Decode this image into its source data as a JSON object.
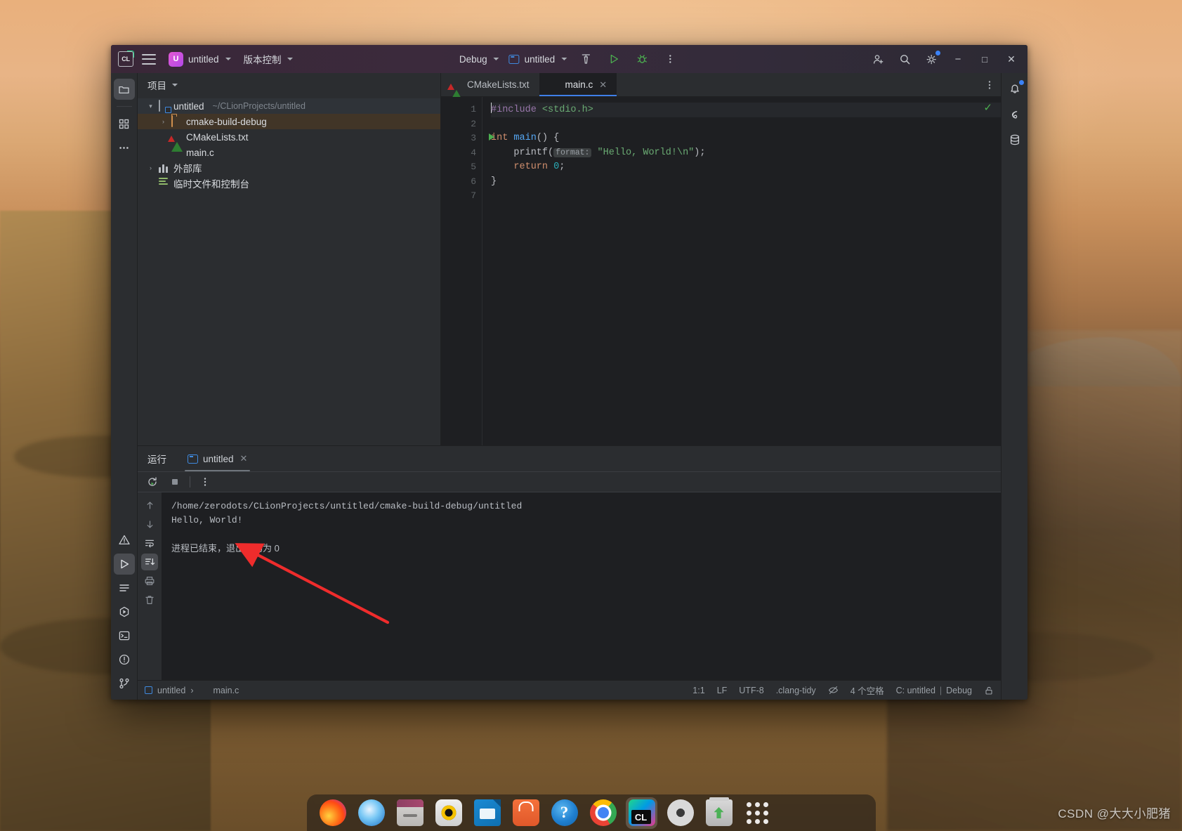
{
  "titlebar": {
    "logo": "CL",
    "menu_icon": "hamburger-menu-icon",
    "project_badge": "U",
    "project_name": "untitled",
    "vcs_label": "版本控制",
    "run_config_label": "Debug",
    "target_label": "untitled",
    "build_icon": "hammer-icon",
    "run_icon": "run-icon",
    "debug_icon": "debug-bug-icon",
    "more_icon": "more-vertical-icon",
    "account_icon": "add-user-icon",
    "search_icon": "search-icon",
    "settings_icon": "gear-icon",
    "minimize": "−",
    "maximize": "□",
    "close": "✕"
  },
  "rail_left": {
    "top": [
      {
        "name": "project-tool-window",
        "icon": "folder-icon",
        "active": true
      },
      {
        "name": "structure-tool-window",
        "icon": "blocks-icon",
        "active": false
      },
      {
        "name": "more-tool-windows",
        "icon": "ellipsis-icon",
        "active": false
      }
    ],
    "bottom": [
      {
        "name": "problems-tool-window",
        "icon": "warning-triangle-icon",
        "active": false
      },
      {
        "name": "run-tool-window",
        "icon": "run-icon",
        "active": true
      },
      {
        "name": "todo-tool-window",
        "icon": "list-lines-icon",
        "active": false
      },
      {
        "name": "debug-tool-window",
        "icon": "debug-hex-icon",
        "active": false
      },
      {
        "name": "terminal-tool-window",
        "icon": "terminal-icon",
        "active": false
      },
      {
        "name": "notifications-tool-window",
        "icon": "exclamation-circle-icon",
        "active": false
      },
      {
        "name": "git-tool-window",
        "icon": "git-branch-icon",
        "active": false
      }
    ]
  },
  "rail_right": [
    {
      "name": "notifications",
      "icon": "bell-icon",
      "badge": true
    },
    {
      "name": "ai-assistant",
      "icon": "spiral-icon",
      "badge": false
    },
    {
      "name": "database",
      "icon": "database-icon",
      "badge": false
    }
  ],
  "project_panel": {
    "title": "项目",
    "tree": [
      {
        "indent": 0,
        "twisty": "▾",
        "icon": "project-folder-icon",
        "label": "untitled",
        "sub": "~/CLionProjects/untitled",
        "state": "selected-blue"
      },
      {
        "indent": 1,
        "twisty": "›",
        "icon": "folder-icon",
        "label": "cmake-build-debug",
        "sub": "",
        "state": "selected-brown"
      },
      {
        "indent": 1,
        "twisty": "",
        "icon": "cmake-icon",
        "label": "CMakeLists.txt",
        "sub": "",
        "state": ""
      },
      {
        "indent": 1,
        "twisty": "",
        "icon": "c-file-icon",
        "label": "main.c",
        "sub": "",
        "state": ""
      },
      {
        "indent": 0,
        "twisty": "›",
        "icon": "library-icon",
        "label": "外部库",
        "sub": "",
        "state": ""
      },
      {
        "indent": 0,
        "twisty": "",
        "icon": "scratches-icon",
        "label": "临时文件和控制台",
        "sub": "",
        "state": ""
      }
    ]
  },
  "editor": {
    "tabs": [
      {
        "label": "CMakeLists.txt",
        "icon": "cmake-icon",
        "active": false,
        "closable": false
      },
      {
        "label": "main.c",
        "icon": "c-file-icon",
        "active": true,
        "closable": true
      }
    ],
    "tab_close_glyph": "✕",
    "options_icon": "more-vertical-icon",
    "inspection_status_icon": "checkmark-icon",
    "line_numbers": [
      "1",
      "2",
      "3",
      "4",
      "5",
      "6",
      "7"
    ],
    "run_gutter_line": 3,
    "code_lines": [
      {
        "n": 1,
        "tokens": [
          {
            "t": "#include ",
            "c": "pre"
          },
          {
            "t": "<stdio.h>",
            "c": "str"
          }
        ]
      },
      {
        "n": 2,
        "tokens": []
      },
      {
        "n": 3,
        "tokens": [
          {
            "t": "int ",
            "c": "kw"
          },
          {
            "t": "main",
            "c": "fn"
          },
          {
            "t": "() {",
            "c": "pl"
          }
        ]
      },
      {
        "n": 4,
        "tokens": [
          {
            "t": "    printf",
            "c": "pl"
          },
          {
            "t": "(",
            "c": "pl"
          },
          {
            "t": "format:",
            "c": "hint"
          },
          {
            "t": " ",
            "c": "pl"
          },
          {
            "t": "\"Hello, World!\\n\"",
            "c": "str"
          },
          {
            "t": ");",
            "c": "pl"
          }
        ]
      },
      {
        "n": 5,
        "tokens": [
          {
            "t": "    ",
            "c": "pl"
          },
          {
            "t": "return ",
            "c": "kw"
          },
          {
            "t": "0",
            "c": "num"
          },
          {
            "t": ";",
            "c": "pl"
          }
        ]
      },
      {
        "n": 6,
        "tokens": [
          {
            "t": "}",
            "c": "pl"
          }
        ]
      },
      {
        "n": 7,
        "tokens": []
      }
    ]
  },
  "run_panel": {
    "title": "运行",
    "tab_label": "untitled",
    "tab_icon": "run-config-icon",
    "tab_close_glyph": "✕",
    "toolbar": [
      {
        "name": "rerun-button",
        "icon": "rerun-icon"
      },
      {
        "name": "stop-button",
        "icon": "stop-square-icon"
      },
      {
        "name": "more-options-button",
        "icon": "more-vertical-icon"
      }
    ],
    "side_buttons": [
      {
        "name": "scroll-up-button",
        "icon": "arrow-up-icon",
        "active": false
      },
      {
        "name": "scroll-down-button",
        "icon": "arrow-down-icon",
        "active": false
      },
      {
        "name": "soft-wrap-button",
        "icon": "soft-wrap-icon",
        "active": false
      },
      {
        "name": "scroll-to-end-button",
        "icon": "scroll-to-end-icon",
        "active": true
      },
      {
        "name": "print-button",
        "icon": "printer-icon",
        "active": false
      },
      {
        "name": "clear-all-button",
        "icon": "trash-icon",
        "active": false
      }
    ],
    "console_lines": [
      "/home/zerodots/CLionProjects/untitled/cmake-build-debug/untitled",
      "Hello, World!",
      "",
      "进程已结束，退出代码为 0"
    ]
  },
  "statusbar": {
    "breadcrumb": [
      {
        "icon": "module-icon",
        "label": "untitled"
      },
      {
        "icon": "c-file-icon",
        "label": "main.c"
      }
    ],
    "separator": "›",
    "caret_position": "1:1",
    "line_separator": "LF",
    "encoding": "UTF-8",
    "inspection": ".clang-tidy",
    "inspection_icon": "inspections-eye-icon",
    "indent": "4 个空格",
    "toolchain": "C: untitled",
    "toolchain_sep": "|",
    "build_type": "Debug",
    "lock_icon": "unlock-icon"
  },
  "dock": {
    "items": [
      {
        "name": "firefox",
        "icon": "firefox-icon",
        "cls": "ic-firefox",
        "active": false
      },
      {
        "name": "thunderbird",
        "icon": "thunderbird-icon",
        "cls": "ic-thunderbird",
        "active": false
      },
      {
        "name": "files",
        "icon": "files-icon",
        "cls": "ic-files",
        "active": false
      },
      {
        "name": "rhythmbox",
        "icon": "music-icon",
        "cls": "ic-rhythm",
        "active": false
      },
      {
        "name": "libreoffice",
        "icon": "document-icon",
        "cls": "ic-libre",
        "active": false
      },
      {
        "name": "software-center",
        "icon": "shopping-bag-icon",
        "cls": "ic-software",
        "active": false
      },
      {
        "name": "help",
        "icon": "question-icon",
        "cls": "ic-help",
        "active": false
      },
      {
        "name": "chrome",
        "icon": "chrome-icon",
        "cls": "ic-chrome",
        "active": false
      },
      {
        "name": "clion",
        "icon": "clion-icon",
        "cls": "ic-clion",
        "active": true
      },
      {
        "name": "disks",
        "icon": "disc-icon",
        "cls": "ic-disks",
        "active": false
      },
      {
        "name": "trash",
        "icon": "trash-icon",
        "cls": "ic-trash",
        "active": false
      },
      {
        "name": "show-applications",
        "icon": "grid-apps-icon",
        "cls": "ic-apps",
        "active": false
      }
    ]
  },
  "watermark": "CSDN @大大小肥猪",
  "annotation": {
    "type": "arrow",
    "color": "#ef2c2c",
    "points_to": "Hello, World! console output"
  },
  "colors": {
    "accent_blue": "#3f7fe8",
    "window_bg": "#1e1f22",
    "panel_bg": "#2b2d30",
    "titlebar_from": "#3a2738",
    "string_green": "#6aab73",
    "keyword_orange": "#cf8e6d",
    "function_blue": "#56a8f5",
    "number_cyan": "#2aacb8",
    "preproc_purple": "#9876aa",
    "selection_brown": "#413527",
    "annotation_red": "#ef2c2c"
  }
}
